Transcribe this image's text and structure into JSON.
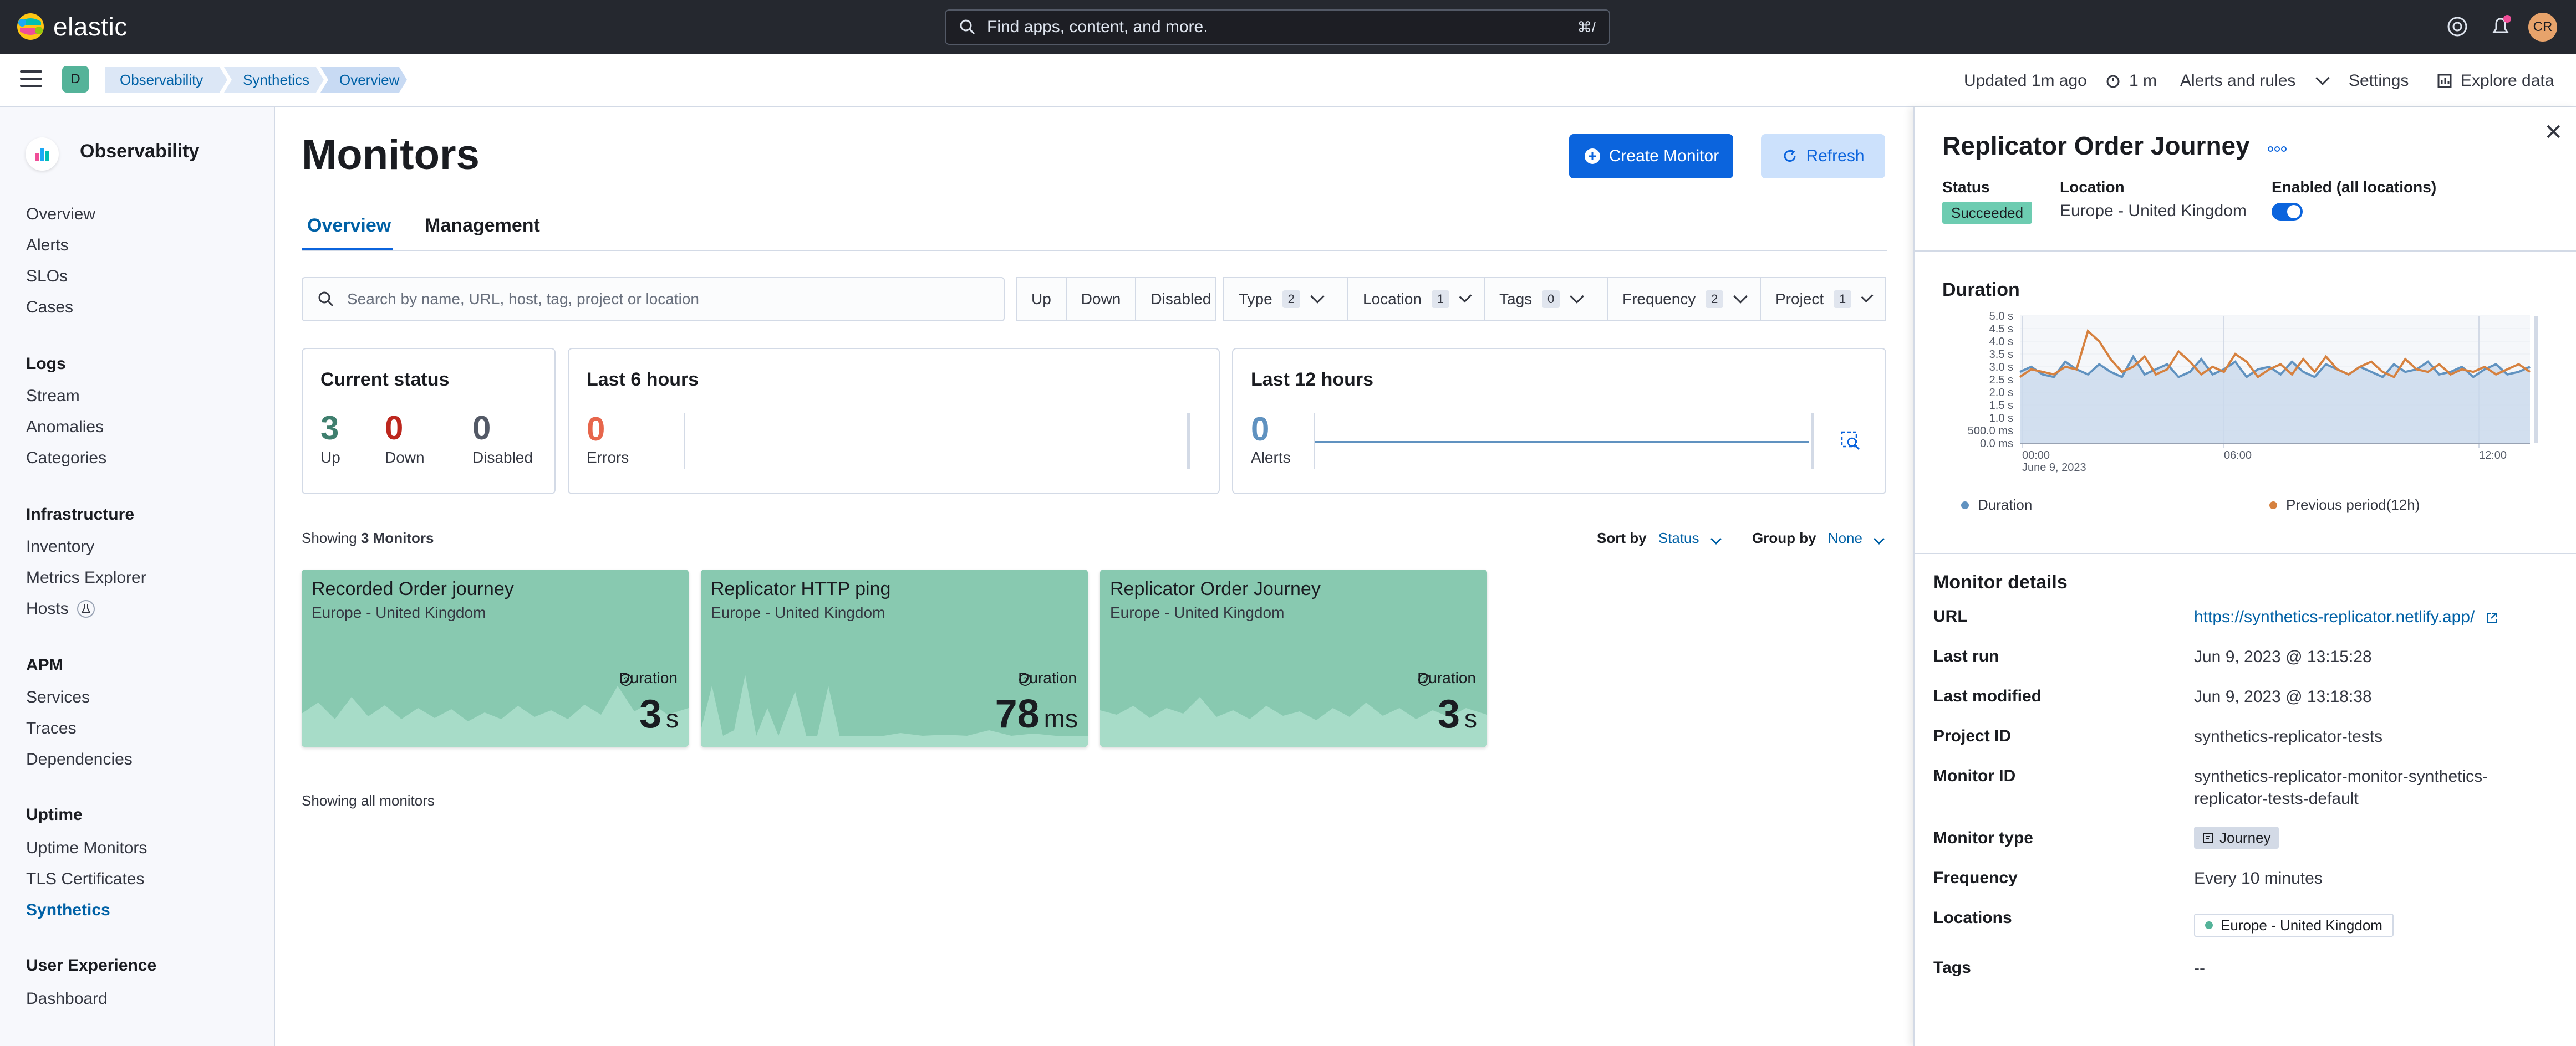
{
  "topbar": {
    "brand": "elastic",
    "search_placeholder": "Find apps, content, and more.",
    "search_shortcut": "⌘/",
    "avatar": "CR"
  },
  "header": {
    "space": "D",
    "breadcrumbs": [
      "Observability",
      "Synthetics",
      "Overview"
    ],
    "updated": "Updated 1m ago",
    "refresh_interval": "1 m",
    "alerts_rules": "Alerts and rules",
    "settings": "Settings",
    "explore": "Explore data"
  },
  "sidebar": {
    "title": "Observability",
    "top_items": [
      "Overview",
      "Alerts",
      "SLOs",
      "Cases"
    ],
    "sections": [
      {
        "title": "Logs",
        "items": [
          "Stream",
          "Anomalies",
          "Categories"
        ]
      },
      {
        "title": "Infrastructure",
        "items": [
          "Inventory",
          "Metrics Explorer",
          "Hosts"
        ]
      },
      {
        "title": "APM",
        "items": [
          "Services",
          "Traces",
          "Dependencies"
        ]
      },
      {
        "title": "Uptime",
        "items": [
          "Uptime Monitors",
          "TLS Certificates",
          "Synthetics"
        ]
      },
      {
        "title": "User Experience",
        "items": [
          "Dashboard"
        ]
      }
    ]
  },
  "main": {
    "title": "Monitors",
    "create_button": "Create Monitor",
    "refresh_button": "Refresh",
    "tabs": [
      "Overview",
      "Management"
    ],
    "search_placeholder": "Search by name, URL, host, tag, project or location",
    "status_filters": [
      "Up",
      "Down",
      "Disabled"
    ],
    "filters": [
      {
        "label": "Type",
        "count": "2"
      },
      {
        "label": "Location",
        "count": "1"
      },
      {
        "label": "Tags",
        "count": "0"
      },
      {
        "label": "Frequency",
        "count": "2"
      },
      {
        "label": "Project",
        "count": "1"
      }
    ],
    "current_status": {
      "title": "Current status",
      "up": "3",
      "up_label": "Up",
      "down": "0",
      "down_label": "Down",
      "disabled": "0",
      "disabled_label": "Disabled"
    },
    "last6": {
      "title": "Last 6 hours",
      "errors": "0",
      "errors_label": "Errors"
    },
    "last12": {
      "title": "Last 12 hours",
      "alerts": "0",
      "alerts_label": "Alerts"
    },
    "showing_prefix": "Showing",
    "showing_count": "3 Monitors",
    "sort_label": "Sort by",
    "sort_value": "Status",
    "group_label": "Group by",
    "group_value": "None",
    "duration_label": "Duration",
    "cards": [
      {
        "name": "Recorded Order journey",
        "location": "Europe - United Kingdom",
        "value": "3",
        "unit": "s"
      },
      {
        "name": "Replicator HTTP ping",
        "location": "Europe - United Kingdom",
        "value": "78",
        "unit": "ms"
      },
      {
        "name": "Replicator Order Journey",
        "location": "Europe - United Kingdom",
        "value": "3",
        "unit": "s"
      }
    ],
    "showing_all": "Showing all monitors"
  },
  "flyout": {
    "title": "Replicator Order Journey",
    "status_label": "Status",
    "status_value": "Succeeded",
    "location_label": "Location",
    "location_value": "Europe - United Kingdom",
    "enabled_label": "Enabled (all locations)",
    "duration_title": "Duration",
    "legend_duration": "Duration",
    "legend_previous": "Previous period(12h)",
    "details_title": "Monitor details",
    "details": {
      "url_label": "URL",
      "url": "https://synthetics-replicator.netlify.app/",
      "last_run_label": "Last run",
      "last_run": "Jun 9, 2023 @ 13:15:28",
      "last_modified_label": "Last modified",
      "last_modified": "Jun 9, 2023 @ 13:18:38",
      "project_label": "Project ID",
      "project": "synthetics-replicator-tests",
      "monitor_id_label": "Monitor ID",
      "monitor_id_1": "synthetics-replicator-monitor-synthetics-",
      "monitor_id_2": "replicator-tests-default",
      "type_label": "Monitor type",
      "type": "Journey",
      "frequency_label": "Frequency",
      "frequency": "Every 10 minutes",
      "locations_label": "Locations",
      "location": "Europe - United Kingdom",
      "tags_label": "Tags",
      "tags": "--"
    }
  },
  "chart_data": {
    "type": "area",
    "title": "Duration",
    "y_ticks": [
      "0.0 ms",
      "500.0 ms",
      "1.0 s",
      "1.5 s",
      "2.0 s",
      "2.5 s",
      "3.0 s",
      "3.5 s",
      "4.0 s",
      "4.5 s",
      "5.0 s"
    ],
    "x_ticks": [
      "00:00",
      "06:00",
      "12:00"
    ],
    "x_date": "June 9, 2023",
    "ylim": [
      0,
      5
    ],
    "series": [
      {
        "name": "Duration",
        "color": "#6092c0",
        "values": [
          2.8,
          3.0,
          2.7,
          2.6,
          3.2,
          2.9,
          2.7,
          3.1,
          2.8,
          2.6,
          3.4,
          2.7,
          2.9,
          3.1,
          2.6,
          2.8,
          3.3,
          2.7,
          2.9,
          3.2,
          2.6,
          2.9,
          3.0,
          2.7,
          3.2,
          2.8,
          2.6,
          3.1,
          2.9,
          2.7,
          3.0,
          2.8,
          2.6,
          3.1,
          2.8,
          2.9,
          3.2,
          2.7,
          2.8,
          3.0,
          2.6,
          2.9,
          3.1,
          2.7,
          2.8,
          3.0
        ]
      },
      {
        "name": "Previous period(12h)",
        "color": "#d6813f",
        "values": [
          2.6,
          2.9,
          2.8,
          2.7,
          3.0,
          2.9,
          4.4,
          4.0,
          3.3,
          2.8,
          3.0,
          3.4,
          2.7,
          2.9,
          3.6,
          3.2,
          2.7,
          3.0,
          2.8,
          3.5,
          3.2,
          2.6,
          2.9,
          3.1,
          2.7,
          3.3,
          2.8,
          3.4,
          2.9,
          2.7,
          3.0,
          3.2,
          2.8,
          2.6,
          3.3,
          2.9,
          2.8,
          3.1,
          2.7,
          2.9,
          2.8,
          3.0,
          2.7,
          2.9,
          3.1,
          2.8
        ]
      }
    ]
  },
  "colors": {
    "accent": "#0b64dd",
    "success": "#6dccb1",
    "card": "#88c9b0",
    "danger": "#bd271e"
  }
}
